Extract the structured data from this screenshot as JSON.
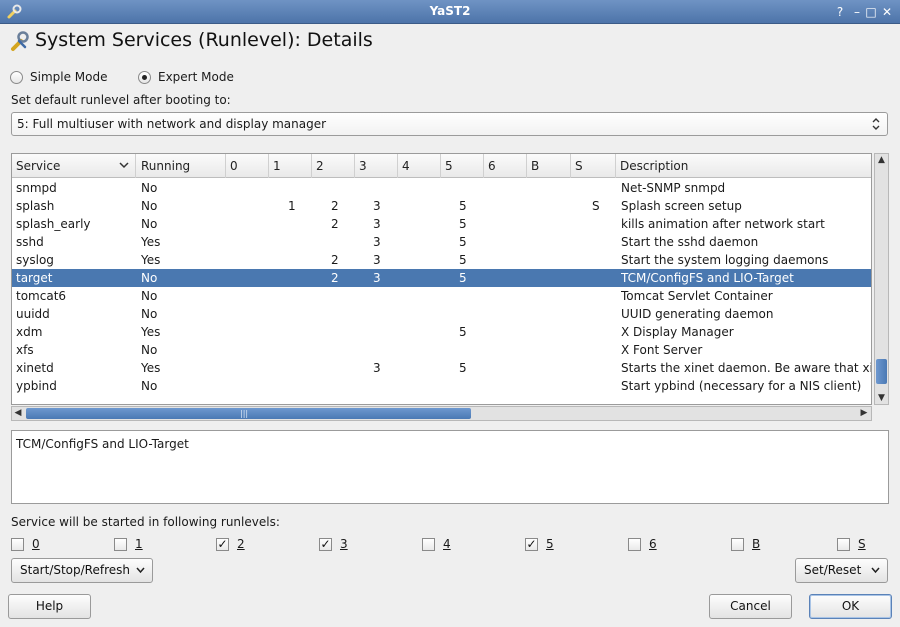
{
  "window": {
    "title": "YaST2",
    "heading": "System Services (Runlevel): Details"
  },
  "mode": {
    "simple_label": "Simple Mode",
    "expert_label": "Expert Mode",
    "selected": "expert"
  },
  "runlevel": {
    "label": "Set default runlevel after booting to:",
    "selected": "5: Full multiuser with network and display manager"
  },
  "table": {
    "columns": [
      "Service",
      "Running",
      "0",
      "1",
      "2",
      "3",
      "4",
      "5",
      "6",
      "B",
      "S",
      "Description"
    ],
    "rows": [
      {
        "service": "snmpd",
        "running": "No",
        "r0": "",
        "r1": "",
        "r2": "",
        "r3": "",
        "r4": "",
        "r5": "",
        "r6": "",
        "rb": "",
        "rs": "",
        "description": "Net-SNMP snmpd"
      },
      {
        "service": "splash",
        "running": "No",
        "r0": "",
        "r1": "1",
        "r2": "2",
        "r3": "3",
        "r4": "",
        "r5": "5",
        "r6": "",
        "rb": "",
        "rs": "S",
        "description": "Splash screen setup"
      },
      {
        "service": "splash_early",
        "running": "No",
        "r0": "",
        "r1": "",
        "r2": "2",
        "r3": "3",
        "r4": "",
        "r5": "5",
        "r6": "",
        "rb": "",
        "rs": "",
        "description": "kills animation after network start"
      },
      {
        "service": "sshd",
        "running": "Yes",
        "r0": "",
        "r1": "",
        "r2": "",
        "r3": "3",
        "r4": "",
        "r5": "5",
        "r6": "",
        "rb": "",
        "rs": "",
        "description": "Start the sshd daemon"
      },
      {
        "service": "syslog",
        "running": "Yes",
        "r0": "",
        "r1": "",
        "r2": "2",
        "r3": "3",
        "r4": "",
        "r5": "5",
        "r6": "",
        "rb": "",
        "rs": "",
        "description": "Start the system logging daemons"
      },
      {
        "service": "target",
        "running": "No",
        "r0": "",
        "r1": "",
        "r2": "2",
        "r3": "3",
        "r4": "",
        "r5": "5",
        "r6": "",
        "rb": "",
        "rs": "",
        "description": "TCM/ConfigFS and LIO-Target",
        "selected": true
      },
      {
        "service": "tomcat6",
        "running": "No",
        "r0": "",
        "r1": "",
        "r2": "",
        "r3": "",
        "r4": "",
        "r5": "",
        "r6": "",
        "rb": "",
        "rs": "",
        "description": "Tomcat Servlet Container"
      },
      {
        "service": "uuidd",
        "running": "No",
        "r0": "",
        "r1": "",
        "r2": "",
        "r3": "",
        "r4": "",
        "r5": "",
        "r6": "",
        "rb": "",
        "rs": "",
        "description": "UUID generating daemon"
      },
      {
        "service": "xdm",
        "running": "Yes",
        "r0": "",
        "r1": "",
        "r2": "",
        "r3": "",
        "r4": "",
        "r5": "5",
        "r6": "",
        "rb": "",
        "rs": "",
        "description": "X Display Manager"
      },
      {
        "service": "xfs",
        "running": "No",
        "r0": "",
        "r1": "",
        "r2": "",
        "r3": "",
        "r4": "",
        "r5": "",
        "r6": "",
        "rb": "",
        "rs": "",
        "description": "X Font Server"
      },
      {
        "service": "xinetd",
        "running": "Yes",
        "r0": "",
        "r1": "",
        "r2": "",
        "r3": "3",
        "r4": "",
        "r5": "5",
        "r6": "",
        "rb": "",
        "rs": "",
        "description": "Starts the xinet daemon. Be aware that xine"
      },
      {
        "service": "ypbind",
        "running": "No",
        "r0": "",
        "r1": "",
        "r2": "",
        "r3": "",
        "r4": "",
        "r5": "",
        "r6": "",
        "rb": "",
        "rs": "",
        "description": "Start ypbind (necessary for a NIS client)"
      }
    ]
  },
  "description_box": {
    "text": "TCM/ConfigFS and LIO-Target"
  },
  "runlevels": {
    "label": "Service will be started in following runlevels:",
    "items": [
      {
        "label": "0",
        "checked": false
      },
      {
        "label": "1",
        "checked": false
      },
      {
        "label": "2",
        "checked": true
      },
      {
        "label": "3",
        "checked": true
      },
      {
        "label": "4",
        "checked": false
      },
      {
        "label": "5",
        "checked": true
      },
      {
        "label": "6",
        "checked": false
      },
      {
        "label": "B",
        "checked": false
      },
      {
        "label": "S",
        "checked": false
      }
    ]
  },
  "buttons": {
    "start_stop": "Start/Stop/Refresh",
    "set_reset": "Set/Reset",
    "help": "Help",
    "cancel": "Cancel",
    "ok": "OK"
  },
  "colors": {
    "titlebar": "#5a80b4",
    "selection": "#4a78b0",
    "scroll_thumb": "#5a86c0"
  },
  "icons": {
    "app": "wrench-icon",
    "minimize": "minimize-icon",
    "maximize": "maximize-icon",
    "close": "close-icon"
  }
}
